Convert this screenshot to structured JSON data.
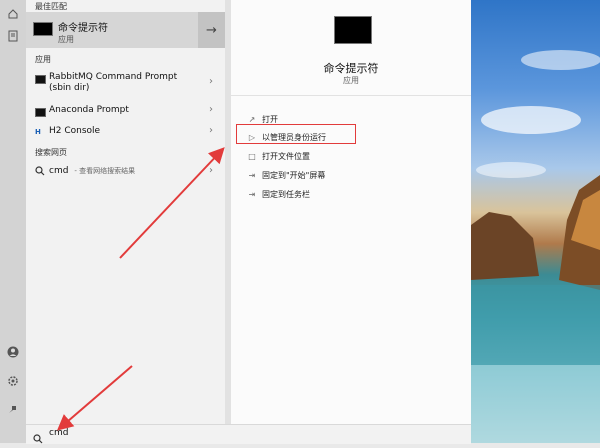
{
  "start_menu": {
    "best_match_header": "最佳匹配",
    "best_match": {
      "title": "命令提示符",
      "subtitle": "应用",
      "open_arrow_icon": "arrow-right-icon"
    },
    "apps_header": "应用",
    "apps": [
      {
        "line1": "RabbitMQ Command Prompt",
        "line2": "(sbin dir)"
      },
      {
        "line1": "Anaconda Prompt"
      },
      {
        "line1": "H2 Console"
      }
    ],
    "web_header": "搜索网页",
    "web_result": {
      "query": "cmd",
      "hint": "- 查看网络搜索结果"
    },
    "detail": {
      "title": "命令提示符",
      "subtitle": "应用",
      "actions": [
        {
          "label": "打开",
          "icon": "open-icon"
        },
        {
          "label": "以管理员身份运行",
          "icon": "admin-shield-icon"
        },
        {
          "label": "打开文件位置",
          "icon": "folder-icon"
        },
        {
          "label": "固定到\"开始\"屏幕",
          "icon": "pin-icon"
        },
        {
          "label": "固定到任务栏",
          "icon": "pin-taskbar-icon"
        }
      ]
    },
    "search": {
      "value": "cmd"
    }
  },
  "colors": {
    "highlight": "#e23b3b",
    "arrow": "#e23b3b"
  }
}
